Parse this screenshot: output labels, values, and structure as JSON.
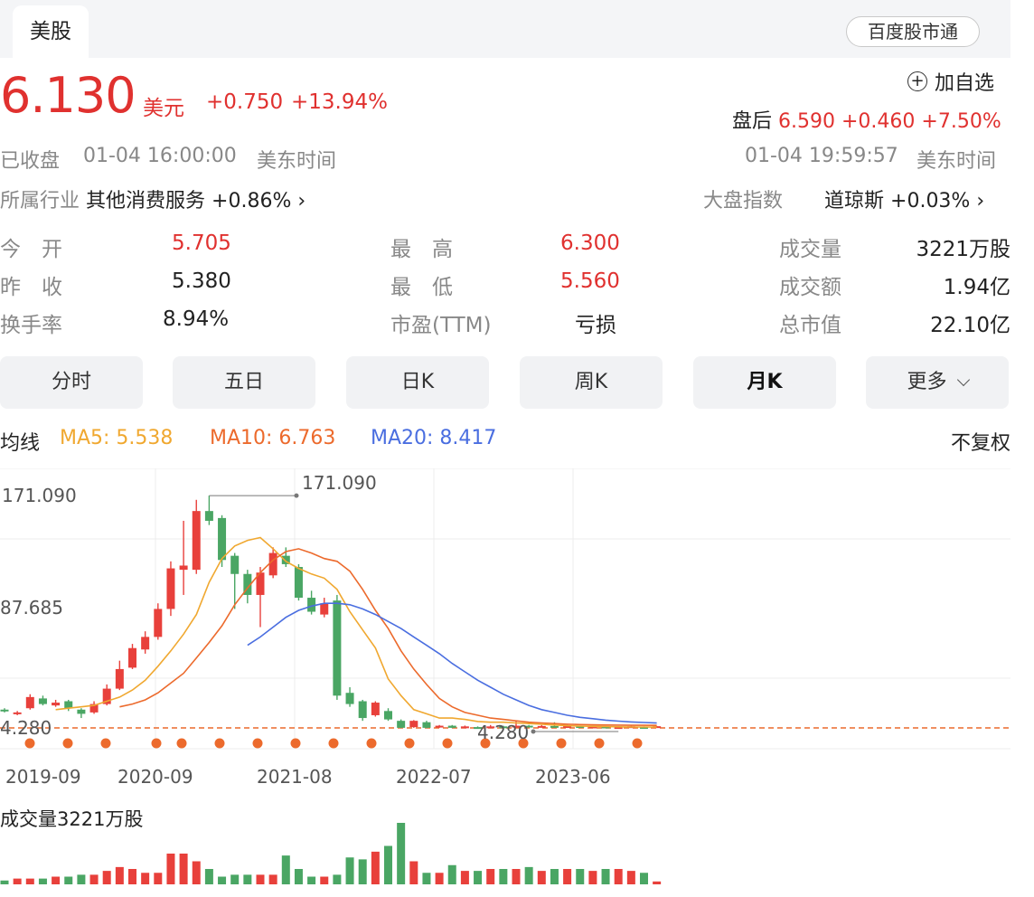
{
  "tabs": {
    "active": "美股",
    "right_button": "百度股市通"
  },
  "quote": {
    "price": "6.130",
    "currency": "美元",
    "change": "+0.750",
    "change_pct": "+13.94%",
    "add_watch": "加自选",
    "after_hours_label": "盘后",
    "after_hours": "6.590 +0.460 +7.50%",
    "status": "已收盘",
    "close_time": "01-04 16:00:00",
    "timezone": "美东时间",
    "after_time": "01-04 19:59:57",
    "after_timezone": "美东时间"
  },
  "industry": {
    "label": "所属行业",
    "name": "其他消费服务",
    "change": "+0.86%"
  },
  "index": {
    "label": "大盘指数",
    "name": "道琼斯",
    "change": "+0.03%"
  },
  "stats": {
    "open_label": "今　开",
    "open": "5.705",
    "high_label": "最　高",
    "high": "6.300",
    "volume_label": "成交量",
    "volume": "3221万股",
    "prev_label": "昨　收",
    "prev": "5.380",
    "low_label": "最　低",
    "low": "5.560",
    "amount_label": "成交额",
    "amount": "1.94亿",
    "turnover_label": "换手率",
    "turnover": "8.94%",
    "pe_label": "市盈(TTM)",
    "pe": "亏损",
    "mcap_label": "总市值",
    "mcap": "22.10亿"
  },
  "period_tabs": [
    "分时",
    "五日",
    "日K",
    "周K",
    "月K",
    "更多"
  ],
  "active_period": "月K",
  "ma": {
    "label": "均线",
    "ma5": "MA5: 5.538",
    "ma10": "MA10: 6.763",
    "ma20": "MA20: 8.417",
    "adjust": "不复权"
  },
  "colors": {
    "up": "#e8403b",
    "down": "#4aa664",
    "ma5": "#f0a830",
    "ma10": "#ec6a2c",
    "ma20": "#4a6ee0",
    "accent": "#e0312f"
  },
  "chart_data": {
    "type": "candlestick",
    "y_ticks": [
      "171.090",
      "87.685",
      "4.280"
    ],
    "x_ticks": [
      "2019-09",
      "2020-09",
      "2021-08",
      "2022-07",
      "2023-06"
    ],
    "max_label": "171.090",
    "min_label": "4.280",
    "ylim": [
      4.28,
      171.09
    ],
    "candles": [
      {
        "o": 18,
        "c": 17,
        "h": 19,
        "l": 16
      },
      {
        "o": 15,
        "c": 16,
        "h": 17,
        "l": 14
      },
      {
        "o": 19,
        "c": 27,
        "h": 29,
        "l": 18
      },
      {
        "o": 26,
        "c": 22,
        "h": 28,
        "l": 21
      },
      {
        "o": 21,
        "c": 23,
        "h": 25,
        "l": 20
      },
      {
        "o": 24,
        "c": 19,
        "h": 25,
        "l": 17
      },
      {
        "o": 18,
        "c": 15,
        "h": 19,
        "l": 12
      },
      {
        "o": 16,
        "c": 22,
        "h": 24,
        "l": 15
      },
      {
        "o": 22,
        "c": 33,
        "h": 36,
        "l": 21
      },
      {
        "o": 33,
        "c": 47,
        "h": 53,
        "l": 32
      },
      {
        "o": 48,
        "c": 62,
        "h": 65,
        "l": 47
      },
      {
        "o": 61,
        "c": 70,
        "h": 74,
        "l": 58
      },
      {
        "o": 70,
        "c": 90,
        "h": 94,
        "l": 68
      },
      {
        "o": 90,
        "c": 119,
        "h": 124,
        "l": 85
      },
      {
        "o": 118,
        "c": 121,
        "h": 153,
        "l": 100
      },
      {
        "o": 118,
        "c": 160,
        "h": 168,
        "l": 115
      },
      {
        "o": 160,
        "c": 153,
        "h": 171,
        "l": 150
      },
      {
        "o": 155,
        "c": 125,
        "h": 157,
        "l": 120
      },
      {
        "o": 128,
        "c": 115,
        "h": 130,
        "l": 90
      },
      {
        "o": 115,
        "c": 100,
        "h": 118,
        "l": 94
      },
      {
        "o": 100,
        "c": 116,
        "h": 120,
        "l": 77
      },
      {
        "o": 114,
        "c": 130,
        "h": 134,
        "l": 112
      },
      {
        "o": 128,
        "c": 122,
        "h": 134,
        "l": 120
      },
      {
        "o": 120,
        "c": 98,
        "h": 122,
        "l": 96
      },
      {
        "o": 98,
        "c": 88,
        "h": 103,
        "l": 86
      },
      {
        "o": 86,
        "c": 94,
        "h": 98,
        "l": 84
      },
      {
        "o": 96,
        "c": 28,
        "h": 100,
        "l": 25
      },
      {
        "o": 30,
        "c": 22,
        "h": 34,
        "l": 20
      },
      {
        "o": 24,
        "c": 12,
        "h": 25,
        "l": 10
      },
      {
        "o": 14,
        "c": 23,
        "h": 24,
        "l": 13
      },
      {
        "o": 17,
        "c": 11,
        "h": 19,
        "l": 10
      },
      {
        "o": 10,
        "c": 5,
        "h": 11,
        "l": 4.8
      },
      {
        "o": 5.5,
        "c": 10,
        "h": 10.5,
        "l": 5
      },
      {
        "o": 9,
        "c": 5,
        "h": 10,
        "l": 4.7
      },
      {
        "o": 5.2,
        "c": 6.5,
        "h": 7,
        "l": 5
      },
      {
        "o": 6.5,
        "c": 5,
        "h": 7,
        "l": 4.8
      },
      {
        "o": 5,
        "c": 6,
        "h": 6.6,
        "l": 4.6
      },
      {
        "o": 5.5,
        "c": 5,
        "h": 6,
        "l": 4.5
      },
      {
        "o": 5,
        "c": 6,
        "h": 7,
        "l": 4.8
      },
      {
        "o": 6,
        "c": 5.3,
        "h": 6.5,
        "l": 5
      },
      {
        "o": 5.3,
        "c": 6.5,
        "h": 10,
        "l": 5.1
      },
      {
        "o": 6.5,
        "c": 6,
        "h": 7,
        "l": 5.5
      },
      {
        "o": 6,
        "c": 6.3,
        "h": 7,
        "l": 5.6
      },
      {
        "o": 6.3,
        "c": 5.8,
        "h": 9,
        "l": 5.5
      },
      {
        "o": 5.8,
        "c": 6.2,
        "h": 7,
        "l": 5.4
      },
      {
        "o": 6.2,
        "c": 5.5,
        "h": 6.5,
        "l": 5.2
      },
      {
        "o": 5.5,
        "c": 5.9,
        "h": 6.5,
        "l": 5.2
      },
      {
        "o": 5.9,
        "c": 5.2,
        "h": 6,
        "l": 5
      },
      {
        "o": 5.2,
        "c": 5.5,
        "h": 6,
        "l": 4.28
      },
      {
        "o": 5.5,
        "c": 6.1,
        "h": 6.4,
        "l": 5.2
      },
      {
        "o": 5.6,
        "c": 5.2,
        "h": 6,
        "l": 5
      },
      {
        "o": 5.38,
        "c": 6.13,
        "h": 6.3,
        "l": 5.56
      }
    ],
    "ma5": [
      null,
      null,
      null,
      null,
      18,
      19,
      20,
      21,
      24,
      27,
      32,
      39,
      49,
      60,
      72,
      86,
      109,
      126,
      135,
      139,
      141,
      133,
      124,
      119,
      115,
      112,
      104,
      88,
      75,
      62,
      40,
      28,
      18,
      15,
      12,
      12,
      11,
      9.5,
      9,
      9,
      8.5,
      8,
      7.5,
      7,
      6.5,
      6.2,
      6,
      5.9,
      5.7,
      5.6,
      5.6,
      5.538
    ],
    "ma10": [
      null,
      null,
      null,
      null,
      null,
      null,
      null,
      null,
      null,
      20,
      22,
      25,
      30,
      37,
      44,
      55,
      66,
      78,
      93,
      105,
      116,
      125,
      131,
      133,
      130,
      126,
      124,
      117,
      104,
      89,
      76,
      60,
      47,
      36,
      26,
      20,
      16,
      14,
      12,
      11,
      10,
      9,
      8.5,
      8,
      7.6,
      7.3,
      7.1,
      7,
      6.9,
      6.8,
      6.78,
      6.763
    ],
    "ma20": [
      null,
      null,
      null,
      null,
      null,
      null,
      null,
      null,
      null,
      null,
      null,
      null,
      null,
      null,
      null,
      null,
      null,
      null,
      null,
      64,
      70,
      77,
      84,
      89,
      92,
      94,
      94,
      93,
      90,
      86,
      81,
      76,
      70,
      64,
      58,
      51,
      45,
      39,
      34,
      29,
      25,
      21,
      18,
      16,
      14,
      12.5,
      11.5,
      10.5,
      9.8,
      9.2,
      8.8,
      8.417
    ],
    "volumes": [
      2,
      3,
      3,
      3,
      4,
      4,
      5,
      5,
      7,
      9,
      8,
      6,
      6,
      16,
      16,
      12,
      8,
      4,
      5,
      5,
      5,
      5,
      15,
      8,
      4,
      4,
      5,
      14,
      13,
      17,
      20,
      32,
      12,
      6,
      6,
      10,
      7,
      7,
      8,
      8,
      8,
      9,
      7,
      8,
      8,
      8,
      7,
      8,
      8,
      7,
      6,
      1.5
    ],
    "volume_label": "成交量3221万股"
  }
}
